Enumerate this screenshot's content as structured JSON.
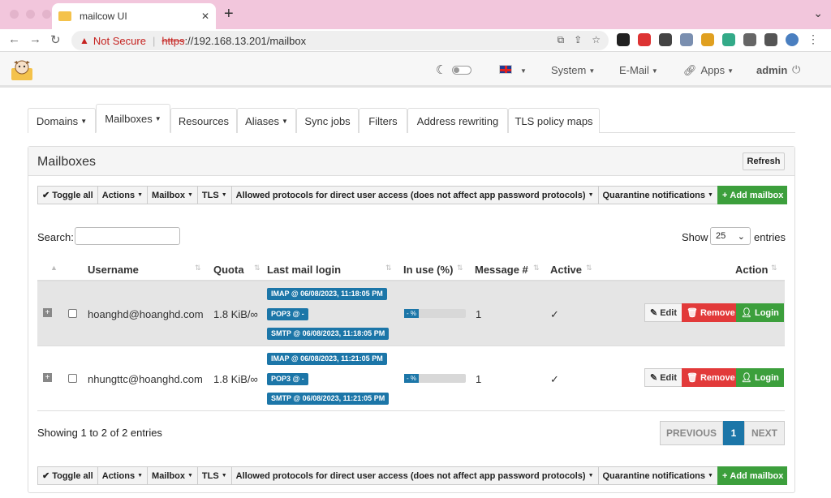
{
  "browser": {
    "tab_title": "mailcow UI",
    "new_tab": "+",
    "security_label": "Not Secure",
    "url_scheme": "https",
    "url_rest": "://192.168.13.201/mailbox"
  },
  "nav": {
    "system": "System",
    "email": "E-Mail",
    "apps": "Apps",
    "user": "admin"
  },
  "tabs": [
    "Domains",
    "Mailboxes",
    "Resources",
    "Aliases",
    "Sync jobs",
    "Filters",
    "Address rewriting",
    "TLS policy maps"
  ],
  "panel": {
    "title": "Mailboxes",
    "refresh": "Refresh"
  },
  "toolbar": {
    "toggle_all": "Toggle all",
    "actions": "Actions",
    "mailbox": "Mailbox",
    "tls": "TLS",
    "protocols": "Allowed protocols for direct user access (does not affect app password protocols)",
    "quarantine": "Quarantine notifications",
    "add_mailbox": "Add mailbox"
  },
  "table": {
    "search_label": "Search:",
    "show_label": "Show",
    "page_size": "25",
    "entries_label": "entries",
    "headers": [
      "Username",
      "Quota",
      "Last mail login",
      "In use (%)",
      "Message #",
      "Active",
      "Action"
    ],
    "rows": [
      {
        "username": "hoanghd@hoanghd.com",
        "quota": "1.8 KiB/∞",
        "imap": "IMAP @ 06/08/2023, 11:18:05 PM",
        "pop3": "POP3 @ -",
        "smtp": "SMTP @ 06/08/2023, 11:18:05 PM",
        "in_use": "- %",
        "messages": "1",
        "active": "✓"
      },
      {
        "username": "nhungttc@hoanghd.com",
        "quota": "1.8 KiB/∞",
        "imap": "IMAP @ 06/08/2023, 11:21:05 PM",
        "pop3": "POP3 @ -",
        "smtp": "SMTP @ 06/08/2023, 11:21:05 PM",
        "in_use": "- %",
        "messages": "1",
        "active": "✓"
      }
    ],
    "edit": "Edit",
    "remove": "Remove",
    "login": "Login",
    "showing": "Showing 1 to 2 of 2 entries",
    "prev": "PREVIOUS",
    "page": "1",
    "next": "NEXT"
  }
}
